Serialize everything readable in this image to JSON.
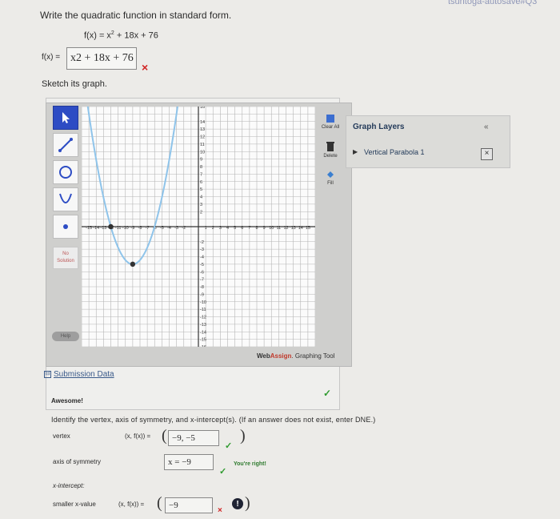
{
  "top_partial_text": "tsuntoga-autosave#Q3",
  "question": {
    "prompt": "Write the quadratic function in standard form.",
    "given_function_lhs": "f(x) = x",
    "given_function_rest": " + 18x + 76",
    "given_exponent": "2",
    "answer_label": "f(x) =",
    "answer_value": "x2 + 18x + 76",
    "answer_status": "×",
    "sketch_prompt": "Sketch its graph."
  },
  "graph_tool": {
    "left_tools": [
      {
        "name": "pointer-tool",
        "icon": "arrow-pointer"
      },
      {
        "name": "line-tool",
        "icon": "line-segment"
      },
      {
        "name": "circle-tool",
        "icon": "circle"
      },
      {
        "name": "parabola-tool",
        "icon": "parabola"
      },
      {
        "name": "point-tool",
        "icon": "point"
      }
    ],
    "no_solution_label": "No Solution",
    "help_label": "Help",
    "right_tools": [
      {
        "label": "Clear All",
        "icon": "clear-icon"
      },
      {
        "label": "Delete",
        "icon": "trash-icon"
      },
      {
        "label": "Fill",
        "icon": "fill-icon"
      }
    ],
    "layers_title": "Graph Layers",
    "layers_collapse": "«",
    "layer_items": [
      "Vertical Parabola 1"
    ],
    "layer_delete": "×",
    "brand_web": "Web",
    "brand_assign": "Assign",
    "brand_suffix": ". Graphing Tool",
    "x_tick_labels": [
      "-15",
      "-14",
      "-13",
      "-12",
      "-11",
      "-10",
      "-9",
      "-8",
      "-7",
      "-6",
      "-5",
      "-4",
      "-3",
      "-2",
      "1",
      "2",
      "3",
      "4",
      "5",
      "6",
      "7",
      "8",
      "9",
      "10",
      "11",
      "12",
      "13",
      "14",
      "15"
    ],
    "y_tick_labels": [
      "16",
      "14",
      "13",
      "12",
      "11",
      "10",
      "9",
      "8",
      "7",
      "6",
      "5",
      "4",
      "3",
      "2",
      "-2",
      "-3",
      "-4",
      "-5",
      "-6",
      "-7",
      "-8",
      "-9",
      "-10",
      "-11",
      "-12",
      "-13",
      "-14",
      "-15",
      "-16"
    ]
  },
  "submission_data_label": "Submission Data",
  "submission_toggle": "⊟",
  "awesome_label": "Awesome!",
  "identify_prompt": "Identify the vertex, axis of symmetry, and x-intercept(s). (If an answer does not exist, enter DNE.)",
  "vertex": {
    "label": "vertex",
    "coord_label": "(x, f(x)) =",
    "value": "−9, −5",
    "status": "✓"
  },
  "axis_of_symmetry": {
    "label": "axis of symmetry",
    "value": "x = −9",
    "status": "✓",
    "message": "You're right!"
  },
  "x_intercept": {
    "label": "x-intercept:",
    "smaller_label": "smaller x-value",
    "coord_label": "(x, f(x)) =",
    "value": "−9",
    "status": "×",
    "warning": "!"
  },
  "colors": {
    "accent_blue": "#2d4cc4",
    "parabola": "#8fc4ea",
    "correct": "#2e9a2e",
    "wrong": "#d12424"
  }
}
